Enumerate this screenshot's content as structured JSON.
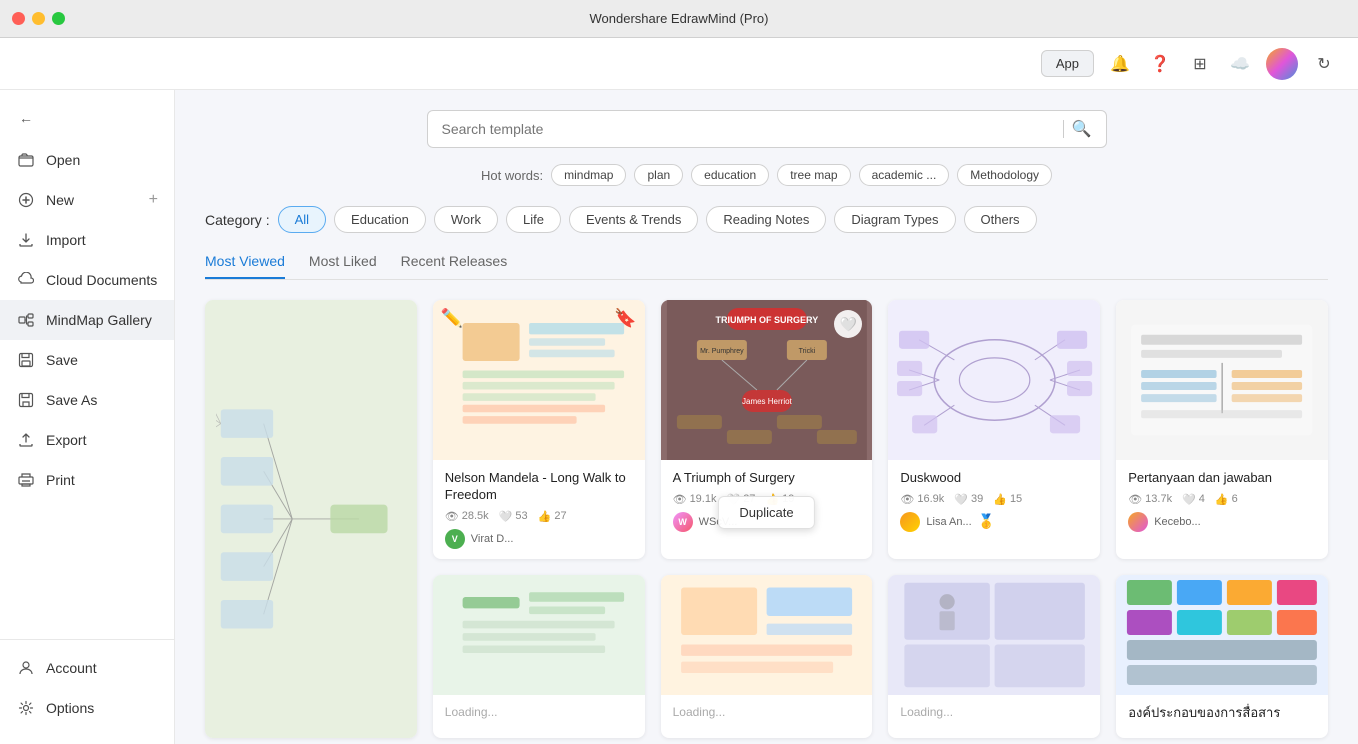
{
  "app": {
    "title": "Wondershare EdrawMind (Pro)"
  },
  "header": {
    "app_btn": "App",
    "avatar_alt": "User avatar"
  },
  "sidebar": {
    "items": [
      {
        "id": "open",
        "label": "Open",
        "icon": "📂"
      },
      {
        "id": "new",
        "label": "New",
        "icon": "➕"
      },
      {
        "id": "import",
        "label": "Import",
        "icon": "⬇️"
      },
      {
        "id": "cloud",
        "label": "Cloud Documents",
        "icon": "☁️"
      },
      {
        "id": "mindmap",
        "label": "MindMap Gallery",
        "icon": "💬",
        "active": true
      },
      {
        "id": "save",
        "label": "Save",
        "icon": "💾"
      },
      {
        "id": "saveas",
        "label": "Save As",
        "icon": "📋"
      },
      {
        "id": "export",
        "label": "Export",
        "icon": "📤"
      },
      {
        "id": "print",
        "label": "Print",
        "icon": "🖨️"
      }
    ],
    "bottom_items": [
      {
        "id": "account",
        "label": "Account",
        "icon": "👤"
      },
      {
        "id": "options",
        "label": "Options",
        "icon": "⚙️"
      }
    ]
  },
  "search": {
    "placeholder": "Search template"
  },
  "hotwords": {
    "label": "Hot words:",
    "tags": [
      "mindmap",
      "plan",
      "education",
      "tree map",
      "academic ...",
      "Methodology"
    ]
  },
  "categories": {
    "label": "Category :",
    "items": [
      {
        "id": "all",
        "label": "All",
        "active": true
      },
      {
        "id": "education",
        "label": "Education"
      },
      {
        "id": "work",
        "label": "Work"
      },
      {
        "id": "life",
        "label": "Life"
      },
      {
        "id": "events",
        "label": "Events & Trends"
      },
      {
        "id": "reading",
        "label": "Reading Notes"
      },
      {
        "id": "diagram",
        "label": "Diagram Types"
      },
      {
        "id": "others",
        "label": "Others"
      }
    ]
  },
  "sort_tabs": [
    {
      "id": "most_viewed",
      "label": "Most Viewed",
      "active": true
    },
    {
      "id": "most_liked",
      "label": "Most Liked"
    },
    {
      "id": "recent",
      "label": "Recent Releases"
    }
  ],
  "cards": [
    {
      "id": "card-large",
      "title": "",
      "large": true,
      "thumb_color": "#e8f0e0",
      "views": "",
      "likes": "",
      "shares": "",
      "author": "",
      "author_avatar_color": "av-green"
    },
    {
      "id": "card-nelson",
      "title": "Nelson Mandela - Long Walk to Freedom",
      "thumb_color": "#fef3e2",
      "views": "28.5k",
      "likes": "53",
      "shares": "27",
      "author": "Virat D...",
      "author_avatar_color": "av-green",
      "author_initial": "V"
    },
    {
      "id": "card-surgery",
      "title": "A Triumph of Surgery",
      "thumb_color": "#8b6b6b",
      "views": "19.1k",
      "likes": "27",
      "shares": "19",
      "author": "WScV...",
      "author_avatar_color": "av-pink",
      "show_duplicate": true,
      "show_heart": true
    },
    {
      "id": "card-duskwood",
      "title": "Duskwood",
      "thumb_color": "#f0eefc",
      "views": "16.9k",
      "likes": "39",
      "shares": "15",
      "author": "Lisa An...",
      "author_avatar_color": "av-orange",
      "has_gold": true
    },
    {
      "id": "card-pertanyaan",
      "title": "Pertanyaan dan jawaban",
      "thumb_color": "#f5f5f5",
      "views": "13.7k",
      "likes": "4",
      "shares": "6",
      "author": "Kecebo...",
      "author_avatar_color": "av-gradient"
    },
    {
      "id": "card-bottom-left",
      "title": "",
      "thumb_color": "#e8f4e8",
      "views": "",
      "likes": "",
      "shares": "",
      "author": ""
    },
    {
      "id": "card-bottom-2",
      "title": "",
      "thumb_color": "#ffeedd",
      "views": "",
      "likes": "",
      "shares": "",
      "author": ""
    },
    {
      "id": "card-bottom-3",
      "title": "",
      "thumb_color": "#f0f0ff",
      "views": "",
      "likes": "",
      "shares": "",
      "author": ""
    },
    {
      "id": "card-siot",
      "title": "องค์ประกอบของการสื่อสาร",
      "thumb_color": "#e8f0fe",
      "views": "",
      "likes": "",
      "shares": "",
      "author": ""
    }
  ],
  "duplicate_label": "Duplicate"
}
